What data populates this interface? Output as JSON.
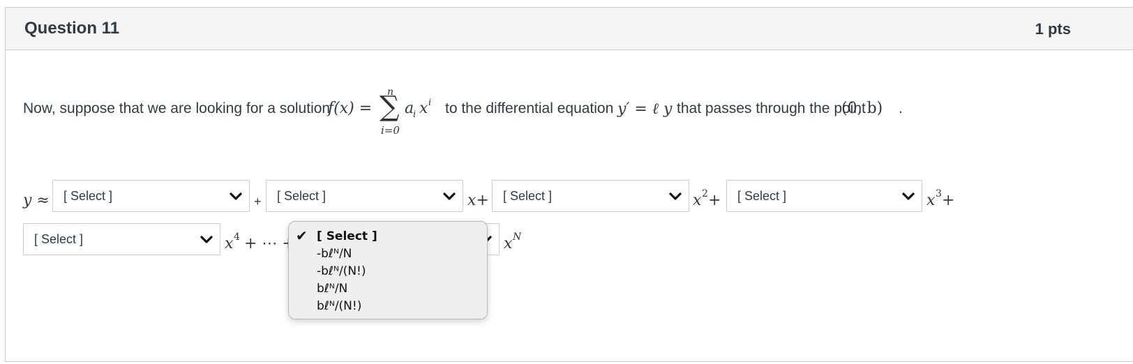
{
  "question": {
    "title": "Question 11",
    "points": "1 pts"
  },
  "prompt": {
    "text_before": "Now, suppose that we are looking for a solution",
    "f_of_x": "f(x) =",
    "sum_upper": "n",
    "sum_lower": "i=0",
    "sum_term": "a",
    "sum_sub": "i",
    "sum_x": "x",
    "sum_sup": "i",
    "text_middle": "to the differential equation",
    "equation": "y′ = ℓ y",
    "text_after": "that passes through the point",
    "point": "(0, b)",
    "period": "."
  },
  "answer": {
    "y_approx": "y ≈",
    "plus1": "+",
    "x_plus": "x+",
    "x2": "x",
    "x2_exp": "2",
    "x2_plus": "+",
    "x3": "x",
    "x3_exp": "3",
    "x3_plus": "+",
    "x4": "x",
    "x4_exp": "4",
    "dots": "+ ⋯ +",
    "xN": "x",
    "xN_exp": "N"
  },
  "selects": {
    "s1": "[ Select ]",
    "s2": "[ Select ]",
    "s3": "[ Select ]",
    "s4": "[ Select ]",
    "s5": "[ Select ]"
  },
  "dropdown": {
    "options": [
      "[ Select ]",
      "-bℓᴺ/N",
      "-bℓᴺ/(N!)",
      "bℓᴺ/N",
      "bℓᴺ/(N!)"
    ],
    "check": "✔"
  }
}
